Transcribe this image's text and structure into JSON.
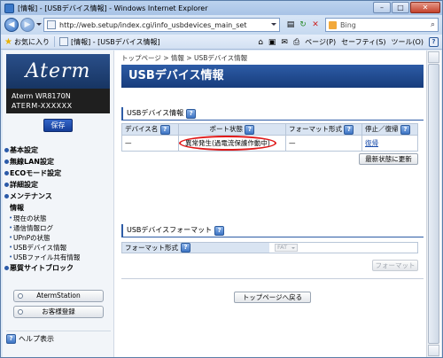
{
  "window": {
    "title": "[情報] - [USBデバイス情報] - Windows Internet Explorer"
  },
  "addressbar": {
    "url": "http://web.setup/index.cgi/info_usbdevices_main_set"
  },
  "search": {
    "engine": "Bing"
  },
  "favorites": {
    "label": "お気に入り",
    "tab_title": "[情報] - [USBデバイス情報]"
  },
  "toolbar": {
    "page": "ページ(P)",
    "safety": "セーフティ(S)",
    "tools": "ツール(O)"
  },
  "sidebar": {
    "logo": "Aterm",
    "device_line1": "Aterm WR8170N",
    "device_line2": "ATERM-XXXXXX",
    "save_label": "保存",
    "menu": [
      "基本設定",
      "無線LAN設定",
      "ECOモード設定",
      "詳細設定",
      "メンテナンス",
      "情報"
    ],
    "submenu": [
      "現在の状態",
      "通信情報ログ",
      "UPnPの状態",
      "USBデバイス情報",
      "USBファイル共有情報"
    ],
    "menu_after": "悪質サイトブロック",
    "button_aterm": "AtermStation",
    "button_register": "お客様登録",
    "help": "ヘルプ表示"
  },
  "main": {
    "breadcrumb": "トップページ > 情報 > USBデバイス情報",
    "page_title": "USBデバイス情報",
    "section1_title": "USBデバイス情報",
    "columns": [
      "デバイス名",
      "ポート状態",
      "フォーマット形式",
      "停止／復帰"
    ],
    "row": {
      "device": "—",
      "port_status": "異常発生(過電流保護作動中)",
      "format": "—",
      "action": "復帰"
    },
    "refresh_label": "最新状態に更新",
    "section2_title": "USBデバイスフォーマット",
    "format_label": "フォーマット形式",
    "format_value": "FAT",
    "format_button": "フォーマット",
    "back_label": "トップページへ戻る"
  },
  "colors": {
    "accent": "#2d5ca6",
    "alert": "#e01818"
  }
}
